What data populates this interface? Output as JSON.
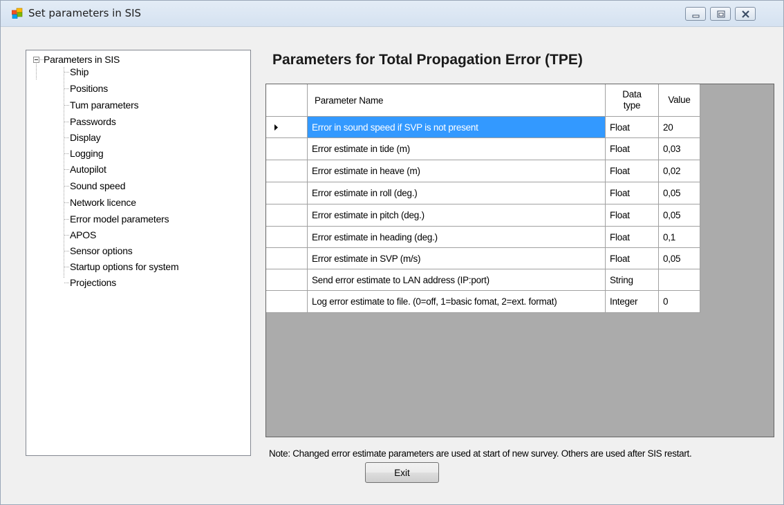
{
  "window": {
    "title": "Set parameters in SIS",
    "icon": "windows-app-icon"
  },
  "tree": {
    "root_label": "Parameters in SIS",
    "expand_icon": "minus-box-icon",
    "items": [
      "Ship",
      "Positions",
      "Tum parameters",
      "Passwords",
      "Display",
      "Logging",
      "Autopilot",
      "Sound speed",
      "Network licence",
      "Error model parameters",
      "APOS",
      "Sensor options",
      "Startup options for system",
      "Projections"
    ]
  },
  "page_title": "Parameters for Total Propagation Error (TPE)",
  "grid": {
    "headers": [
      "Parameter Name",
      "Data type",
      "Value"
    ],
    "current_row_icon": "right-triangle-icon",
    "selected_row": 0,
    "rows": [
      {
        "name": "Error in sound speed if SVP is not present",
        "type": "Float",
        "value": "20"
      },
      {
        "name": "Error estimate in tide (m)",
        "type": "Float",
        "value": "0,03"
      },
      {
        "name": "Error estimate in heave (m)",
        "type": "Float",
        "value": "0,02"
      },
      {
        "name": "Error estimate in roll (deg.)",
        "type": "Float",
        "value": "0,05"
      },
      {
        "name": "Error estimate in pitch (deg.)",
        "type": "Float",
        "value": "0,05"
      },
      {
        "name": "Error estimate in heading (deg.)",
        "type": "Float",
        "value": "0,1"
      },
      {
        "name": "Error estimate in SVP (m/s)",
        "type": "Float",
        "value": "0,05"
      },
      {
        "name": "Send error estimate to LAN address (IP:port)",
        "type": "String",
        "value": ""
      },
      {
        "name": "Log error estimate to file. (0=off, 1=basic fomat, 2=ext. format)",
        "type": "Integer",
        "value": "0"
      }
    ]
  },
  "note": "Note: Changed error estimate parameters are used at start of new survey. Others are used after SIS restart.",
  "exit_label": "Exit",
  "colors": {
    "selection": "#3399ff",
    "grid_background": "#ababab"
  }
}
